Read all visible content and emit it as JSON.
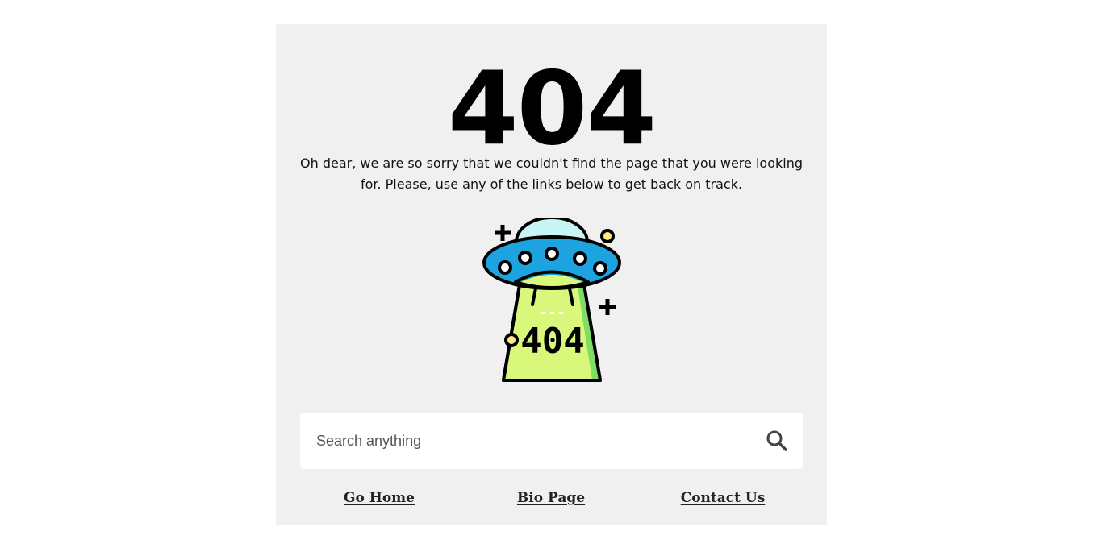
{
  "error": {
    "code": "404",
    "message": "Oh dear, we are so sorry that we couldn't find the page that you were looking for. Please, use any of the links below to get back on track."
  },
  "illustration": {
    "icon": "ufo-404-icon",
    "label": "404"
  },
  "search": {
    "placeholder": "Search anything",
    "icon": "search-icon"
  },
  "links": {
    "home": "Go Home",
    "bio": "Bio Page",
    "contact": "Contact Us"
  },
  "colors": {
    "card_background": "#f0f0f0",
    "saucer_blue": "#1ca3e0",
    "beam_green": "#d9f77a",
    "dome_cyan": "#c8f6f4",
    "light_yellow": "#ffe88a"
  }
}
